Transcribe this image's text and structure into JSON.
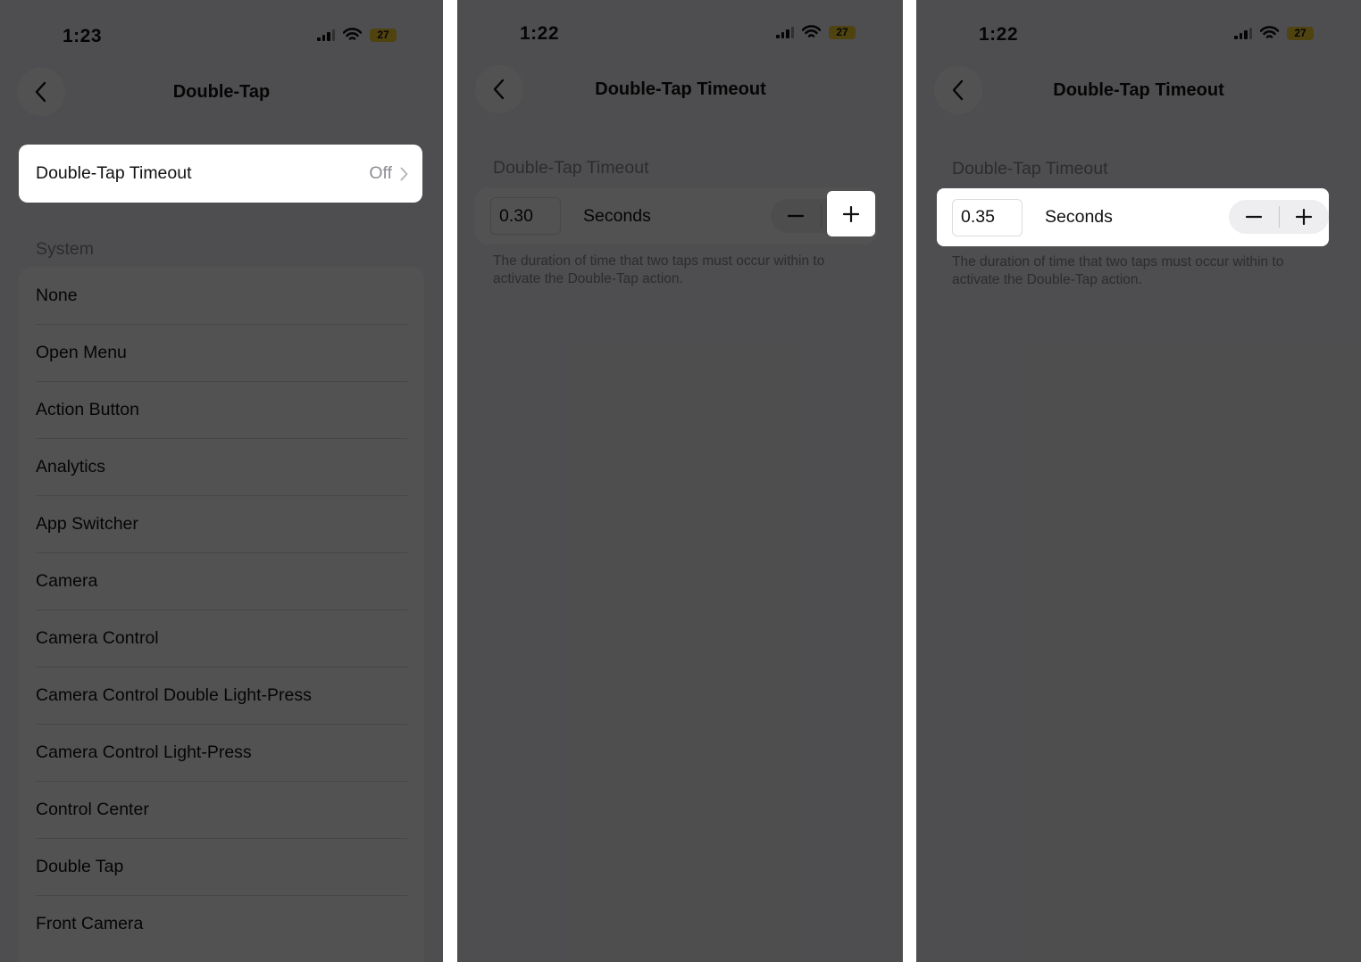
{
  "screens": [
    {
      "time": "1:23",
      "battery": "27",
      "title": "Double-Tap",
      "timeout_row": {
        "label": "Double-Tap Timeout",
        "value": "Off"
      },
      "section_header": "System",
      "items": [
        "None",
        "Open Menu",
        "Action Button",
        "Analytics",
        "App Switcher",
        "Camera",
        "Camera Control",
        "Camera Control Double Light-Press",
        "Camera Control Light-Press",
        "Control Center",
        "Double Tap",
        "Front Camera"
      ]
    },
    {
      "time": "1:22",
      "battery": "27",
      "title": "Double-Tap Timeout",
      "section_header": "Double-Tap Timeout",
      "value": "0.30",
      "unit": "Seconds",
      "footnote": "The duration of time that two taps must occur within to activate the Double-Tap action."
    },
    {
      "time": "1:22",
      "battery": "27",
      "title": "Double-Tap Timeout",
      "section_header": "Double-Tap Timeout",
      "value": "0.35",
      "unit": "Seconds",
      "footnote": "The duration of time that two taps must occur within to activate the Double-Tap action."
    }
  ],
  "icons": {
    "back": "chevron-left-icon",
    "disclosure": "chevron-right-icon",
    "minus": "minus-icon",
    "plus": "plus-icon",
    "signal": "cellular-signal-icon",
    "wifi": "wifi-icon",
    "battery": "battery-icon"
  },
  "colors": {
    "battery": "#f5d033",
    "background": "#f2f2f7",
    "card": "#ffffff",
    "secondary_text": "#8a8a8e"
  }
}
